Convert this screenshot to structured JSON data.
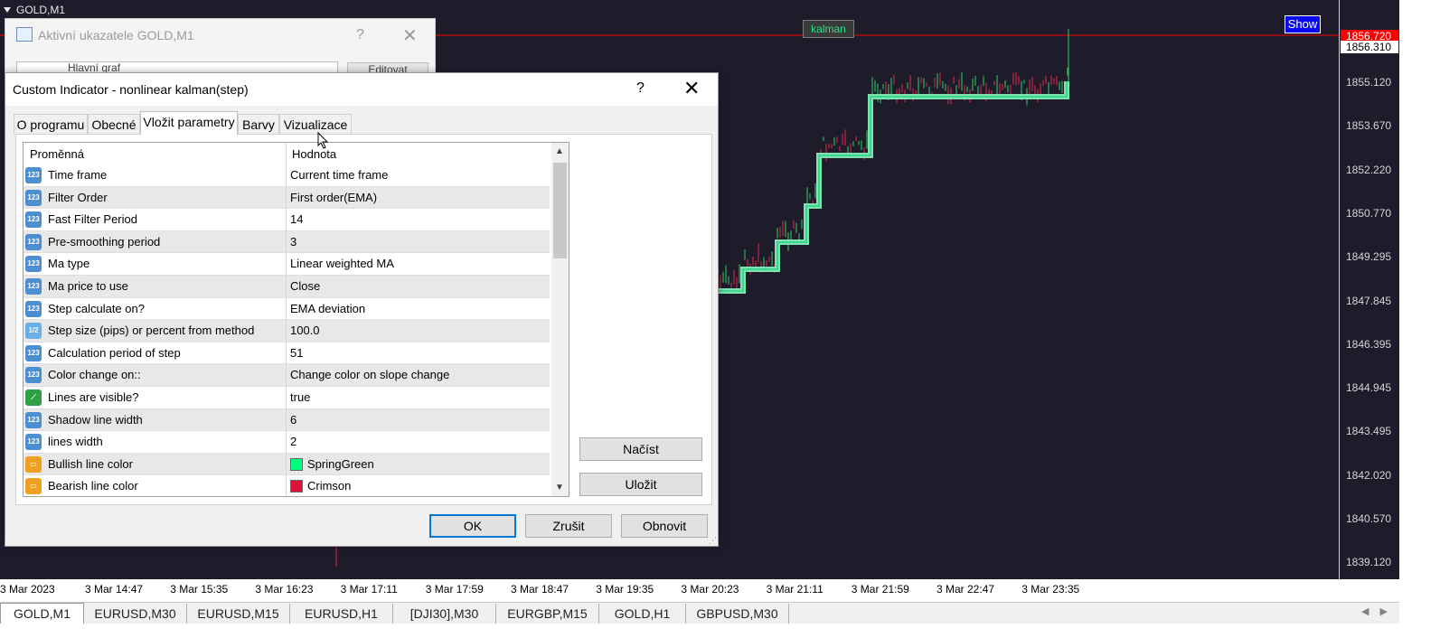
{
  "chart": {
    "title": "GOLD,M1",
    "indicator_label": "kalman",
    "show_button": "Show",
    "current_price": "1856.720",
    "bid_price": "1856.310",
    "price_ticks": [
      "1855.120",
      "1853.670",
      "1852.220",
      "1850.770",
      "1849.295",
      "1847.845",
      "1846.395",
      "1844.945",
      "1843.495",
      "1842.020",
      "1840.570",
      "1839.120"
    ],
    "time_ticks": [
      "3 Mar 2023",
      "3 Mar 14:47",
      "3 Mar 15:35",
      "3 Mar 16:23",
      "3 Mar 17:11",
      "3 Mar 17:59",
      "3 Mar 18:47",
      "3 Mar 19:35",
      "3 Mar 20:23",
      "3 Mar 21:11",
      "3 Mar 21:59",
      "3 Mar 22:47",
      "3 Mar 23:35"
    ],
    "colors": {
      "background": "#1e1c2b",
      "bullish_candle": "#2fd06a",
      "bearish_candle": "#e0284a",
      "kalman_line": "#3ad88e",
      "price_line": "#ff0000"
    }
  },
  "chart_tabs": [
    "GOLD,M1",
    "EURUSD,M30",
    "EURUSD,M15",
    "EURUSD,H1",
    "[DJI30],M30",
    "EURGBP,M15",
    "GOLD,H1",
    "GBPUSD,M30"
  ],
  "bg_dialog": {
    "title": "Aktivní ukazatele GOLD,M1",
    "help": "?",
    "close": "✕",
    "row_label": "Hlavní graf",
    "edit_label": "Editovat"
  },
  "dialog": {
    "title": "Custom Indicator - nonlinear kalman(step)",
    "help": "?",
    "close": "✕",
    "tabs": [
      "O programu",
      "Obecné",
      "Vložit parametry",
      "Barvy",
      "Vizualizace"
    ],
    "active_tab": "Vložit parametry",
    "columns": {
      "name": "Proměnná",
      "value": "Hodnota"
    },
    "params": [
      {
        "name": "Time frame",
        "value": "Current time frame",
        "icon": "123"
      },
      {
        "name": "Filter Order",
        "value": "First order(EMA)",
        "icon": "123"
      },
      {
        "name": "Fast Filter Period",
        "value": "14",
        "icon": "123"
      },
      {
        "name": "Pre-smoothing period",
        "value": "3",
        "icon": "123"
      },
      {
        "name": "Ma type",
        "value": "Linear weighted MA",
        "icon": "123"
      },
      {
        "name": "Ma price to use",
        "value": "Close",
        "icon": "123"
      },
      {
        "name": "Step calculate on?",
        "value": "EMA deviation",
        "icon": "123"
      },
      {
        "name": "Step size (pips) or percent from method",
        "value": "100.0",
        "icon": "1/2"
      },
      {
        "name": "Calculation period of step",
        "value": "51",
        "icon": "123"
      },
      {
        "name": "Color change on::",
        "value": "Change color on slope change",
        "icon": "123"
      },
      {
        "name": "Lines are visible?",
        "value": "true",
        "icon": "line"
      },
      {
        "name": "Shadow  line width",
        "value": "6",
        "icon": "123"
      },
      {
        "name": "lines   width",
        "value": "2",
        "icon": "123"
      },
      {
        "name": "Bullish  line  color",
        "value": "SpringGreen",
        "icon": "color",
        "swatch": "#00ff7f"
      },
      {
        "name": "Bearish  line  color",
        "value": "Crimson",
        "icon": "color",
        "swatch": "#dc143c"
      }
    ],
    "load_button": "Načíst",
    "save_button": "Uložit",
    "ok_button": "OK",
    "cancel_button": "Zrušit",
    "reset_button": "Obnovit"
  }
}
